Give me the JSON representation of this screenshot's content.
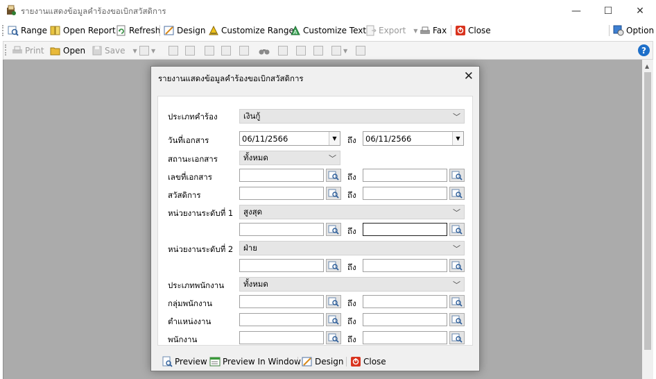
{
  "window": {
    "title": "รายงานแสดงข้อมูลคำร้องขอเบิกสวัสดิการ",
    "minimize": "—",
    "maximize": "☐",
    "close": "✕"
  },
  "toolbar": {
    "range": "Range",
    "open_report": "Open Report",
    "refresh": "Refresh",
    "design": "Design",
    "customize_range": "Customize Range",
    "customize_text": "Customize Text",
    "export": "Export",
    "fax": "Fax",
    "close": "Close",
    "option": "Option"
  },
  "preview_toolbar": {
    "print": "Print",
    "open": "Open",
    "save": "Save",
    "help": "?"
  },
  "dialog": {
    "title": "รายงานแสดงข้อมูลคำร้องขอเบิกสวัสดิการ",
    "close": "✕",
    "to_label": "ถึง",
    "fields": {
      "request_type_label": "ประเภทคำร้อง",
      "request_type_value": "เงินกู้",
      "doc_date_label": "วันที่เอกสาร",
      "doc_date_from": "06/11/2566",
      "doc_date_to": "06/11/2566",
      "doc_status_label": "สถานะเอกสาร",
      "doc_status_value": "ทั้งหมด",
      "doc_no_label": "เลขที่เอกสาร",
      "welfare_label": "สวัสดิการ",
      "unit1_label": "หน่วยงานระดับที่ 1",
      "unit1_value": "สูงสุด",
      "unit2_label": "หน่วยงานระดับที่ 2",
      "unit2_value": "ฝ่าย",
      "emp_type_label": "ประเภทพนักงาน",
      "emp_type_value": "ทั้งหมด",
      "emp_group_label": "กลุ่มพนักงาน",
      "position_label": "ตำแหน่งงาน",
      "employee_label": "พนักงาน"
    },
    "footer": {
      "preview": "Preview",
      "preview_in_window": "Preview In Window",
      "design": "Design",
      "close": "Close"
    }
  },
  "colors": {
    "accent": "#1d6fc9",
    "close_red": "#d9341f",
    "workspace_gray": "#ababab"
  }
}
